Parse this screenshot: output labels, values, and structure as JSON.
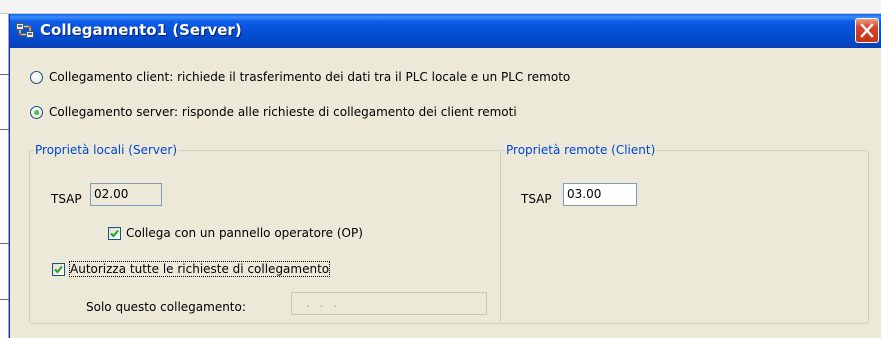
{
  "window": {
    "title": "Collegamento1 (Server)",
    "icon": "network-connection-icon",
    "close_icon": "close-icon"
  },
  "connection_type": {
    "client_label": "Collegamento client: richiede il trasferimento dei dati tra il PLC locale e un PLC remoto",
    "client_selected": false,
    "server_label": "Collegamento server: risponde alle richieste di collegamento dei client remoti",
    "server_selected": true
  },
  "local": {
    "legend": "Proprietà locali (Server)",
    "tsap_label": "TSAP",
    "tsap_value": "02.00",
    "op_checkbox_label": "Collega con un pannello operatore (OP)",
    "op_checked": true,
    "authorize_label": "Autorizza tutte le richieste di collegamento",
    "authorize_checked": true,
    "only_label": "Solo questo collegamento:",
    "only_value": ". . ."
  },
  "remote": {
    "legend": "Proprietà remote (Client)",
    "tsap_label": "TSAP",
    "tsap_value": "03.00"
  },
  "colors": {
    "titlebar": "#0450d4",
    "dialog_bg": "#ece9d8",
    "legend_text": "#0046d5",
    "check_mark": "#21a121",
    "close_button": "#d6452a"
  }
}
